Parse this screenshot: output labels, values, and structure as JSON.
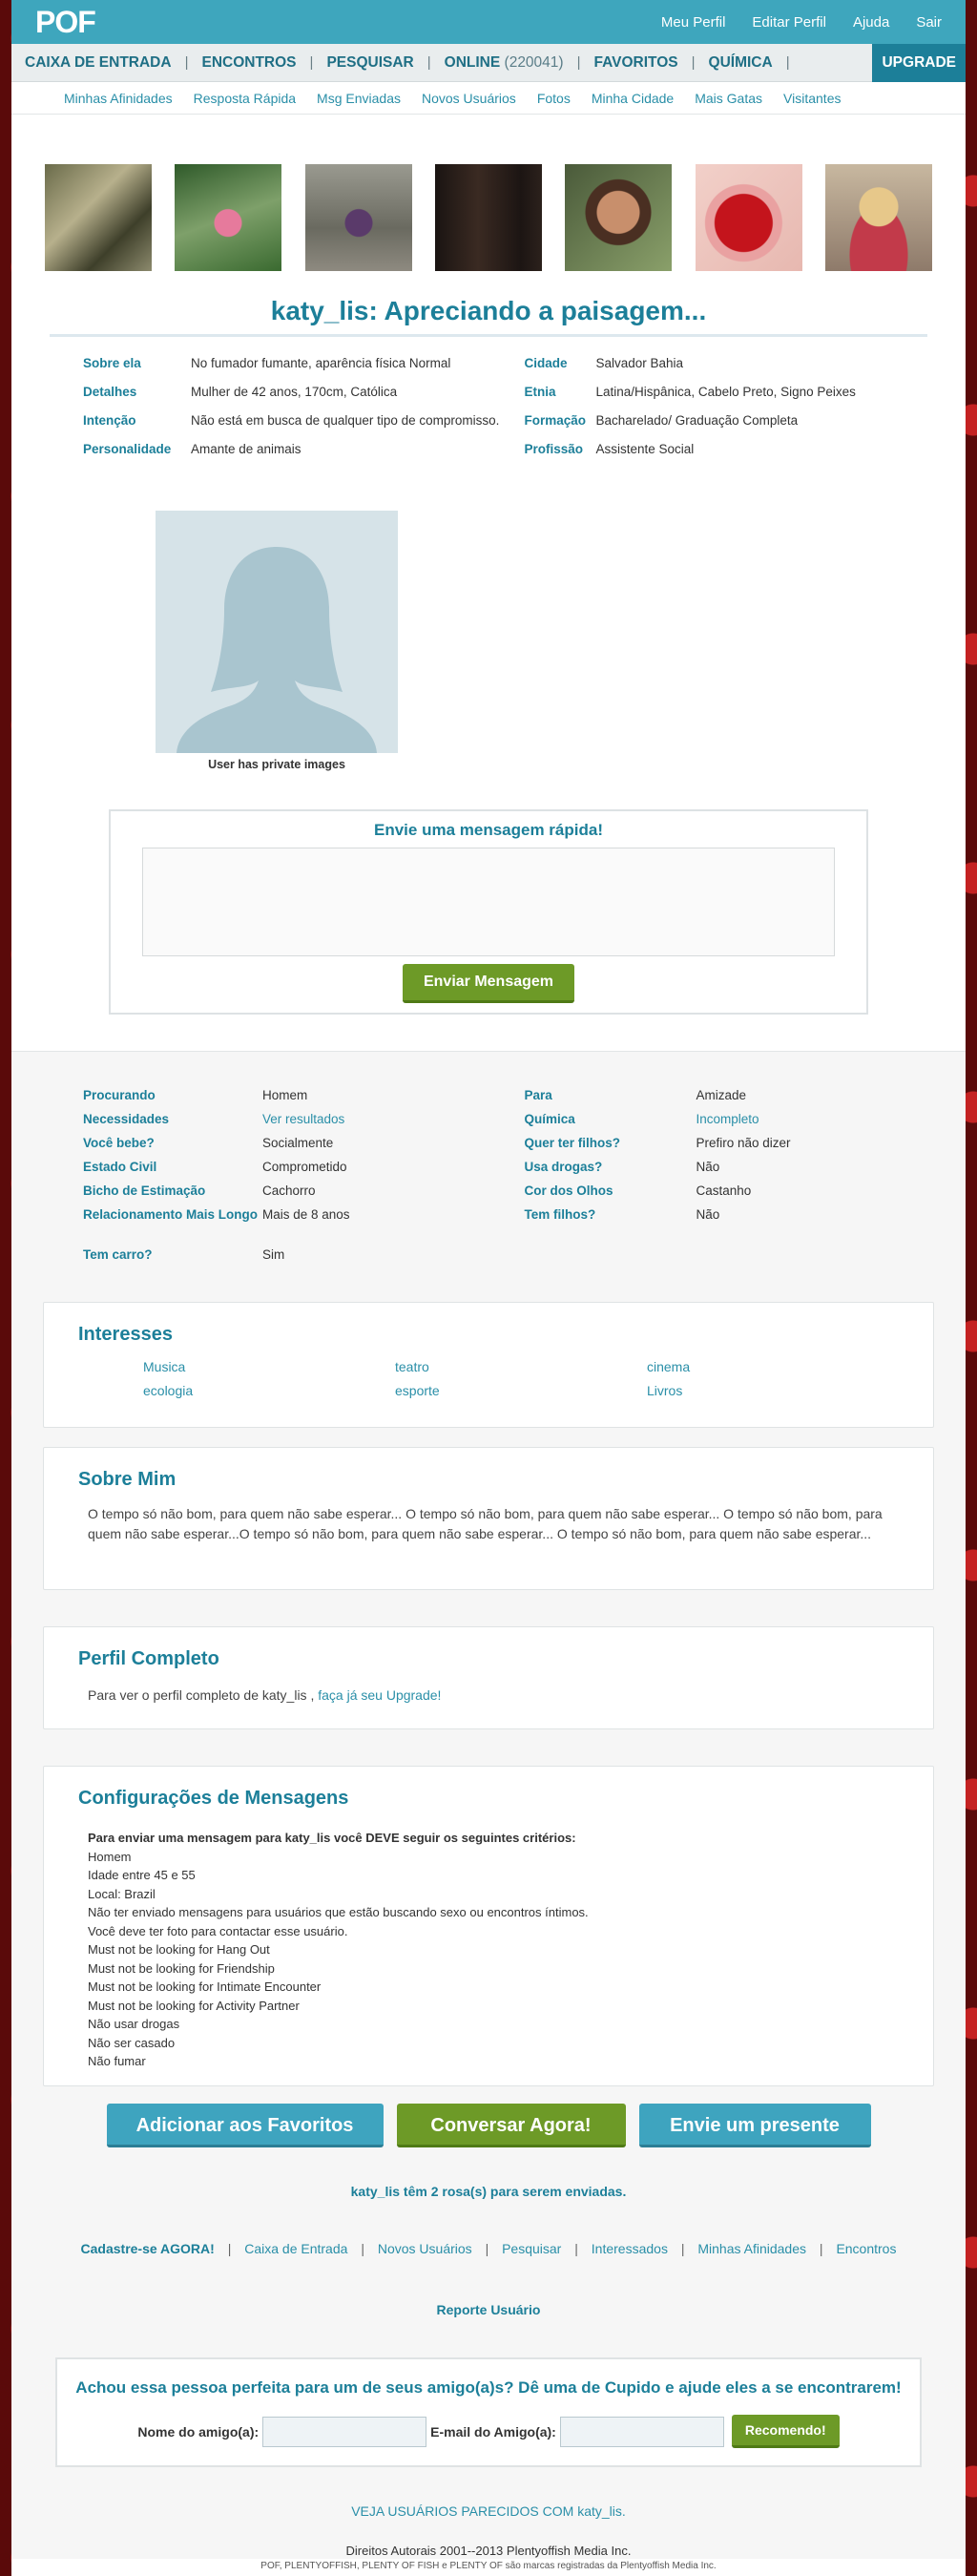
{
  "topbar": {
    "logo": "POF",
    "links": [
      "Meu Perfil",
      "Editar Perfil",
      "Ajuda",
      "Sair"
    ]
  },
  "nav": {
    "inbox": "CAIXA DE ENTRADA",
    "meet": "ENCONTROS",
    "search": "PESQUISAR",
    "online": "ONLINE",
    "online_count": "(220041)",
    "favorites": "FAVORITOS",
    "chemistry": "QUÍMICA",
    "upgrade": "UPGRADE",
    "separator": "|"
  },
  "subnav": [
    "Minhas Afinidades",
    "Resposta Rápida",
    "Msg Enviadas",
    "Novos Usuários",
    "Fotos",
    "Minha Cidade",
    "Mais Gatas",
    "Visitantes"
  ],
  "profile": {
    "headline": "katy_lis: Apreciando a paisagem...",
    "details_left": [
      {
        "label": "Sobre ela",
        "value": "No fumador fumante, aparência física Normal"
      },
      {
        "label": "Detalhes",
        "value": "Mulher de 42 anos, 170cm, Católica"
      },
      {
        "label": "Intenção",
        "value": "Não está em busca de qualquer tipo de compromisso."
      },
      {
        "label": "Personalidade",
        "value": "Amante de animais"
      }
    ],
    "details_right": [
      {
        "label": "Cidade",
        "value": "Salvador Bahia"
      },
      {
        "label": "Etnia",
        "value": "Latina/Hispânica, Cabelo Preto, Signo Peixes"
      },
      {
        "label": "Formação",
        "value": "Bacharelado/ Graduação Completa"
      },
      {
        "label": "Profissão",
        "value": "Assistente Social"
      }
    ],
    "private_caption": "User has private images"
  },
  "quick_message": {
    "title": "Envie uma mensagem rápida!",
    "textarea_value": "",
    "button": "Enviar Mensagem"
  },
  "attributes": {
    "left": [
      {
        "label": "Procurando",
        "value": "Homem",
        "link": false
      },
      {
        "label": "Necessidades",
        "value": "Ver resultados",
        "link": true
      },
      {
        "label": "Você bebe?",
        "value": "Socialmente",
        "link": false
      },
      {
        "label": "Estado Civil",
        "value": "Comprometido",
        "link": false
      },
      {
        "label": "Bicho de Estimação",
        "value": "Cachorro",
        "link": false
      },
      {
        "label": "Relacionamento Mais Longo",
        "value": "Mais de 8 anos",
        "link": false
      },
      {
        "label": "Tem carro?",
        "value": "Sim",
        "link": false
      }
    ],
    "right": [
      {
        "label": "Para",
        "value": "Amizade",
        "link": false
      },
      {
        "label": "Química",
        "value": "Incompleto",
        "link": true
      },
      {
        "label": "Quer ter filhos?",
        "value": "Prefiro não dizer",
        "link": false
      },
      {
        "label": "Usa drogas?",
        "value": "Não",
        "link": false
      },
      {
        "label": "Cor dos Olhos",
        "value": "Castanho",
        "link": false
      },
      {
        "label": "Tem filhos?",
        "value": "Não",
        "link": false
      }
    ]
  },
  "interests": {
    "title": "Interesses",
    "items": [
      "Musica",
      "teatro",
      "cinema",
      "ecologia",
      "esporte",
      "Livros"
    ]
  },
  "about": {
    "title": "Sobre Mim",
    "text": "O tempo só não bom, para quem não sabe esperar... O tempo só não bom, para quem não sabe esperar... O tempo só não bom, para quem não sabe esperar...O tempo só não bom, para quem não sabe esperar... O tempo só não bom, para quem não sabe esperar..."
  },
  "complete_profile": {
    "title": "Perfil Completo",
    "text": "Para ver o perfil completo de katy_lis ,",
    "link": "faça já seu Upgrade!"
  },
  "message_settings": {
    "title": "Configurações de Mensagens",
    "intro": "Para enviar uma mensagem para katy_lis você DEVE seguir os seguintes critérios:",
    "rules": [
      "Homem",
      "Idade entre 45 e 55",
      "Local: Brazil",
      "Não ter enviado mensagens para usuários que estão buscando sexo ou encontros íntimos.",
      "Você deve ter foto para contactar esse usuário.",
      "Must not be looking for Hang Out",
      "Must not be looking for Friendship",
      "Must not be looking for Intimate Encounter",
      "Must not be looking for Activity Partner",
      "Não usar drogas",
      "Não ser casado",
      "Não fumar"
    ]
  },
  "actions": {
    "favorite": "Adicionar aos Favoritos",
    "chat": "Conversar Agora!",
    "gift": "Envie um presente"
  },
  "roses_text": "katy_lis têm 2 rosa(s) para serem enviadas.",
  "footer_links": {
    "first": "Cadastre-se AGORA!",
    "items": [
      "Caixa de Entrada",
      "Novos Usuários",
      "Pesquisar",
      "Interessados",
      "Minhas Afinidades",
      "Encontros"
    ]
  },
  "report": "Reporte Usuário",
  "cupid": {
    "title": "Achou essa pessoa perfeita para um de seus amigo(a)s? Dê uma de Cupido e ajude eles a se encontrarem!",
    "name_label": "Nome do amigo(a):",
    "email_label": "E-mail do Amigo(a):",
    "name_value": "",
    "email_value": "",
    "button": "Recomendo!"
  },
  "similar": "VEJA USUÁRIOS PARECIDOS COM katy_lis.",
  "copyright": "Direitos Autorais 2001--2013 Plentyoffish Media Inc.",
  "trademark": "POF, PLENTYOFFISH, PLENTY OF FISH e PLENTY OF são marcas registradas da Plentyoffish Media Inc."
}
